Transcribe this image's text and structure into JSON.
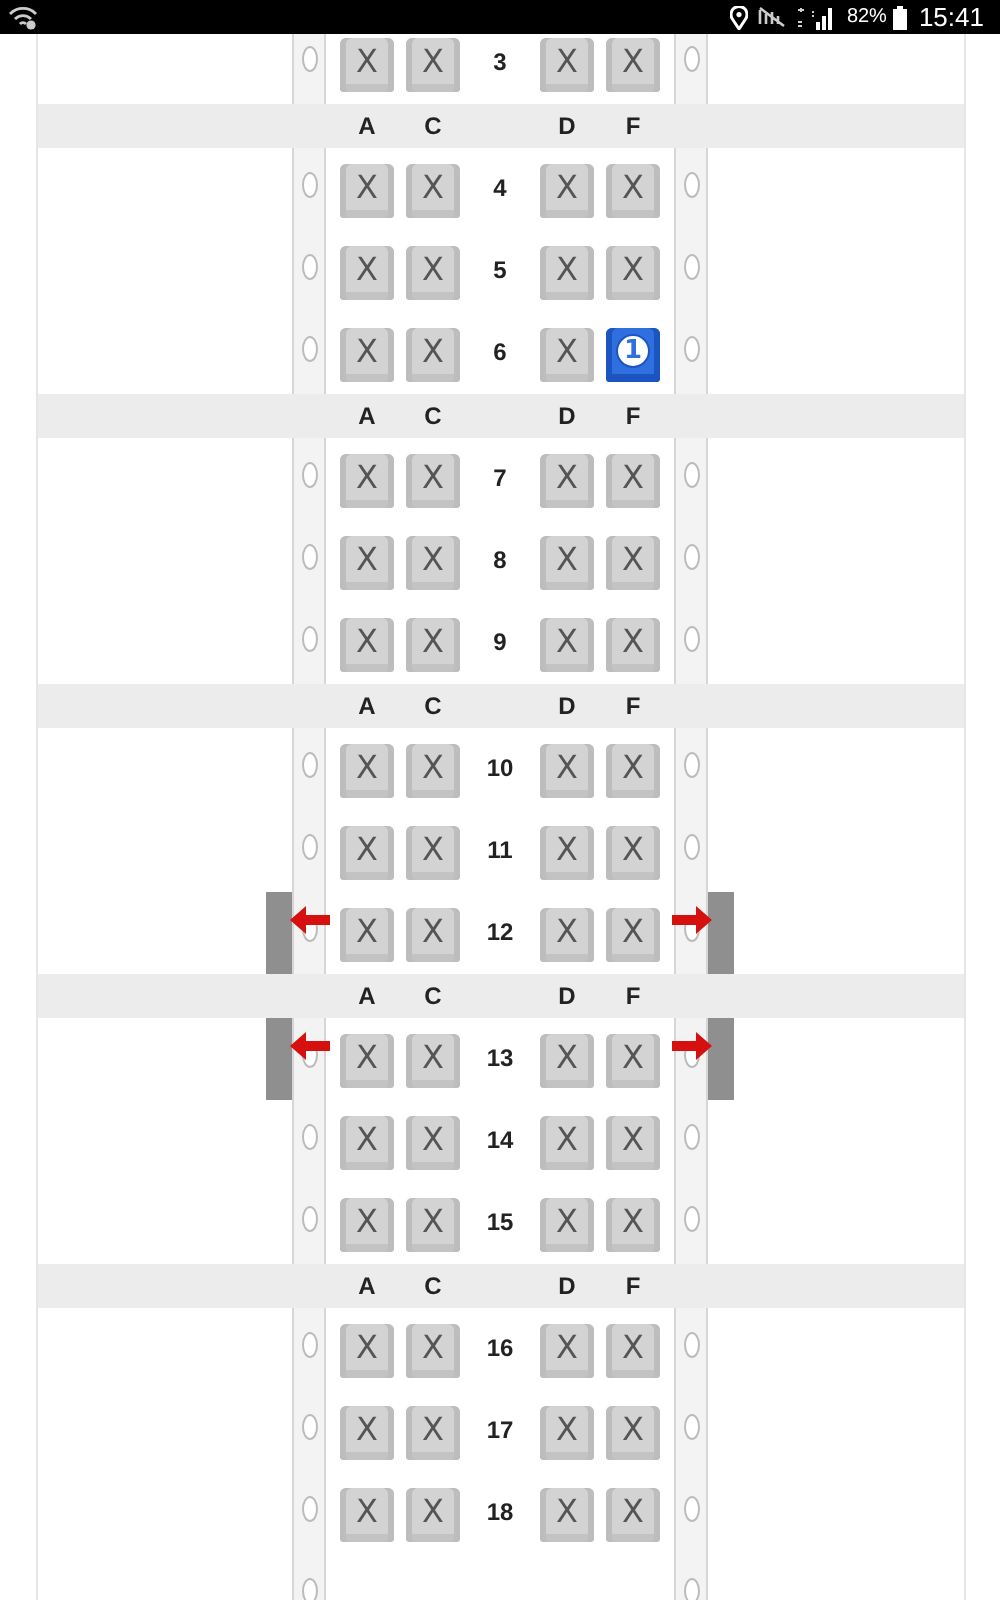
{
  "status_bar": {
    "battery": "82%",
    "time": "15:41"
  },
  "sections": [
    {
      "rows": [
        {
          "number": "3",
          "exit": false,
          "seats": [
            {
              "text": "X",
              "selected": false
            },
            {
              "text": "X",
              "selected": false
            },
            {
              "text": "X",
              "selected": false
            },
            {
              "text": "X",
              "selected": false
            }
          ]
        }
      ]
    },
    {
      "columns": [
        "A",
        "C",
        "D",
        "F"
      ],
      "rows": [
        {
          "number": "4",
          "exit": false,
          "seats": [
            {
              "text": "X",
              "selected": false
            },
            {
              "text": "X",
              "selected": false
            },
            {
              "text": "X",
              "selected": false
            },
            {
              "text": "X",
              "selected": false
            }
          ]
        },
        {
          "number": "5",
          "exit": false,
          "seats": [
            {
              "text": "X",
              "selected": false
            },
            {
              "text": "X",
              "selected": false
            },
            {
              "text": "X",
              "selected": false
            },
            {
              "text": "X",
              "selected": false
            }
          ]
        },
        {
          "number": "6",
          "exit": false,
          "seats": [
            {
              "text": "X",
              "selected": false
            },
            {
              "text": "X",
              "selected": false
            },
            {
              "text": "X",
              "selected": false
            },
            {
              "text": "1",
              "selected": true
            }
          ]
        }
      ]
    },
    {
      "columns": [
        "A",
        "C",
        "D",
        "F"
      ],
      "rows": [
        {
          "number": "7",
          "exit": false,
          "seats": [
            {
              "text": "X",
              "selected": false
            },
            {
              "text": "X",
              "selected": false
            },
            {
              "text": "X",
              "selected": false
            },
            {
              "text": "X",
              "selected": false
            }
          ]
        },
        {
          "number": "8",
          "exit": false,
          "seats": [
            {
              "text": "X",
              "selected": false
            },
            {
              "text": "X",
              "selected": false
            },
            {
              "text": "X",
              "selected": false
            },
            {
              "text": "X",
              "selected": false
            }
          ]
        },
        {
          "number": "9",
          "exit": false,
          "seats": [
            {
              "text": "X",
              "selected": false
            },
            {
              "text": "X",
              "selected": false
            },
            {
              "text": "X",
              "selected": false
            },
            {
              "text": "X",
              "selected": false
            }
          ]
        }
      ]
    },
    {
      "columns": [
        "A",
        "C",
        "D",
        "F"
      ],
      "rows": [
        {
          "number": "10",
          "exit": false,
          "seats": [
            {
              "text": "X",
              "selected": false
            },
            {
              "text": "X",
              "selected": false
            },
            {
              "text": "X",
              "selected": false
            },
            {
              "text": "X",
              "selected": false
            }
          ]
        },
        {
          "number": "11",
          "exit": false,
          "seats": [
            {
              "text": "X",
              "selected": false
            },
            {
              "text": "X",
              "selected": false
            },
            {
              "text": "X",
              "selected": false
            },
            {
              "text": "X",
              "selected": false
            }
          ]
        },
        {
          "number": "12",
          "exit": true,
          "seats": [
            {
              "text": "X",
              "selected": false
            },
            {
              "text": "X",
              "selected": false
            },
            {
              "text": "X",
              "selected": false
            },
            {
              "text": "X",
              "selected": false
            }
          ]
        }
      ]
    },
    {
      "columns": [
        "A",
        "C",
        "D",
        "F"
      ],
      "rows": [
        {
          "number": "13",
          "exit": true,
          "seats": [
            {
              "text": "X",
              "selected": false
            },
            {
              "text": "X",
              "selected": false
            },
            {
              "text": "X",
              "selected": false
            },
            {
              "text": "X",
              "selected": false
            }
          ]
        },
        {
          "number": "14",
          "exit": false,
          "seats": [
            {
              "text": "X",
              "selected": false
            },
            {
              "text": "X",
              "selected": false
            },
            {
              "text": "X",
              "selected": false
            },
            {
              "text": "X",
              "selected": false
            }
          ]
        },
        {
          "number": "15",
          "exit": false,
          "seats": [
            {
              "text": "X",
              "selected": false
            },
            {
              "text": "X",
              "selected": false
            },
            {
              "text": "X",
              "selected": false
            },
            {
              "text": "X",
              "selected": false
            }
          ]
        }
      ]
    },
    {
      "columns": [
        "A",
        "C",
        "D",
        "F"
      ],
      "rows": [
        {
          "number": "16",
          "exit": false,
          "seats": [
            {
              "text": "X",
              "selected": false
            },
            {
              "text": "X",
              "selected": false
            },
            {
              "text": "X",
              "selected": false
            },
            {
              "text": "X",
              "selected": false
            }
          ]
        },
        {
          "number": "17",
          "exit": false,
          "seats": [
            {
              "text": "X",
              "selected": false
            },
            {
              "text": "X",
              "selected": false
            },
            {
              "text": "X",
              "selected": false
            },
            {
              "text": "X",
              "selected": false
            }
          ]
        },
        {
          "number": "18",
          "exit": false,
          "seats": [
            {
              "text": "X",
              "selected": false
            },
            {
              "text": "X",
              "selected": false
            },
            {
              "text": "X",
              "selected": false
            },
            {
              "text": "X",
              "selected": false
            }
          ]
        }
      ]
    }
  ]
}
